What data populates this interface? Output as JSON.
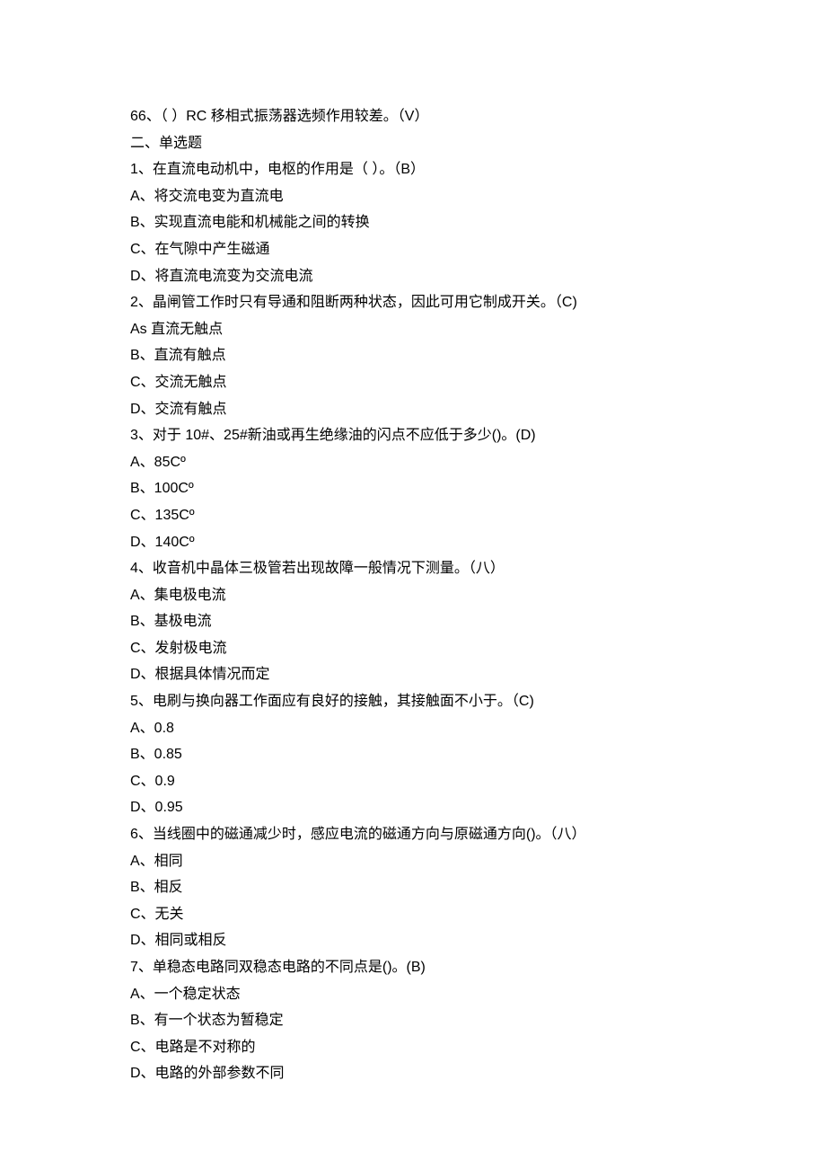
{
  "lines": [
    "66、（ ）RC 移相式振荡器选频作用较差。（V）",
    "二、单选题",
    "1、在直流电动机中，电枢的作用是（ ）。（B）",
    "A、将交流电变为直流电",
    "B、实现直流电能和机械能之间的转换",
    "C、在气隙中产生磁通",
    "D、将直流电流变为交流电流",
    "2、晶闸管工作时只有导通和阻断两种状态，因此可用它制成开关。（C)",
    "As 直流无触点",
    "B、直流有触点",
    "C、交流无触点",
    "D、交流有触点",
    "3、对于 10#、25#新油或再生绝缘油的闪点不应低于多少()。(D)",
    "A、85Cº",
    "B、100Cº",
    "C、135Cº",
    "D、140Cº",
    "4、收音机中晶体三极管若出现故障一般情况下测量。（八）",
    "A、集电极电流",
    "B、基极电流",
    "C、发射极电流",
    "D、根据具体情况而定",
    "5、电刷与换向器工作面应有良好的接触，其接触面不小于。（C)",
    "A、0.8",
    "B、0.85",
    "C、0.9",
    "D、0.95",
    "6、当线圈中的磁通减少时，感应电流的磁通方向与原磁通方向()。（八）",
    "A、相同",
    "B、相反",
    "C、无关",
    "D、相同或相反",
    "7、单稳态电路同双稳态电路的不同点是()。(B)",
    "A、一个稳定状态",
    "B、有一个状态为暂稳定",
    "C、电路是不对称的",
    "D、电路的外部参数不同"
  ]
}
